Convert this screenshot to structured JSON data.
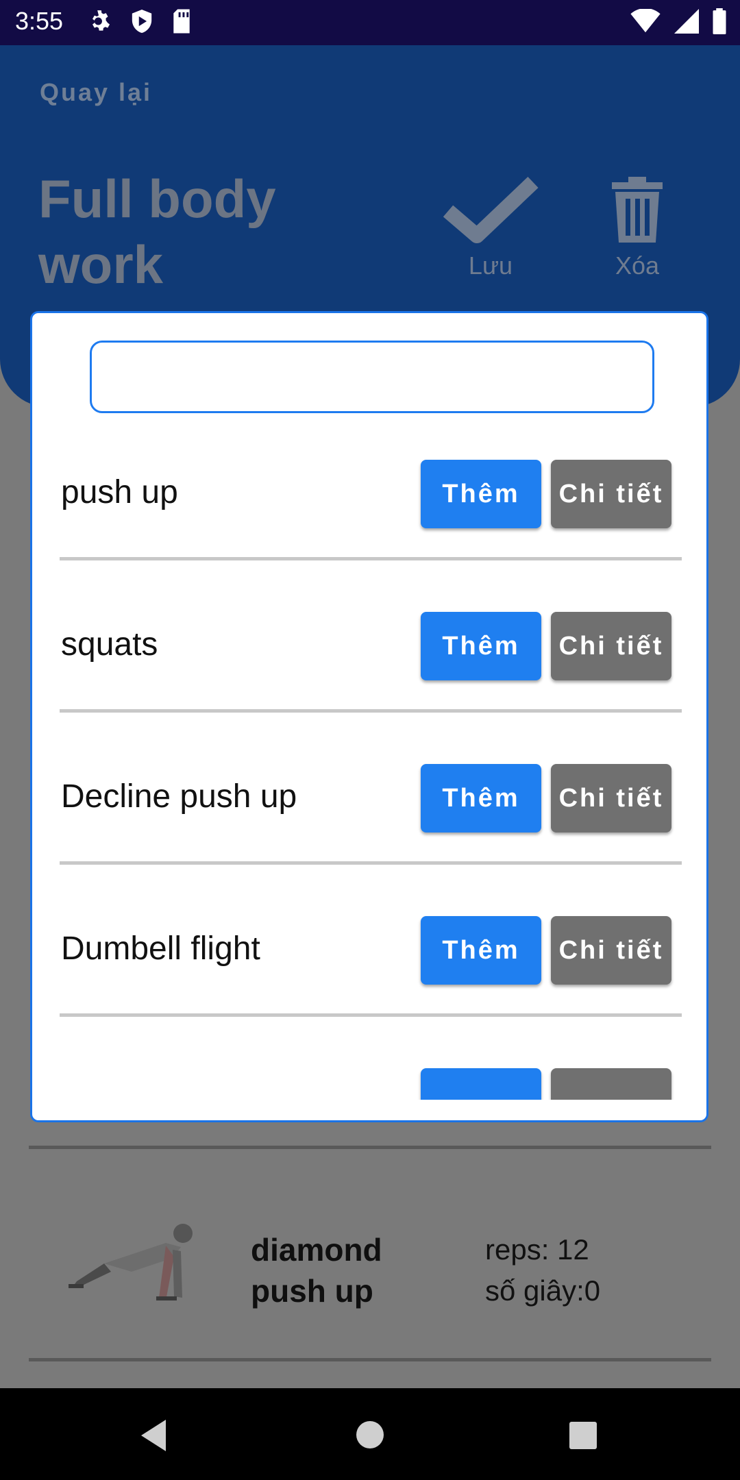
{
  "status_bar": {
    "time": "3:55"
  },
  "header": {
    "back_label": "Quay lại",
    "title": "Full body work",
    "save_label": "Lưu",
    "delete_label": "Xóa"
  },
  "dialog": {
    "search_value": "",
    "exercises": [
      {
        "name": "push up",
        "add_label": "Thêm",
        "detail_label": "Chi tiết"
      },
      {
        "name": "squats",
        "add_label": "Thêm",
        "detail_label": "Chi tiết"
      },
      {
        "name": "Decline push up",
        "add_label": "Thêm",
        "detail_label": "Chi tiết"
      },
      {
        "name": "Dumbell flight",
        "add_label": "Thêm",
        "detail_label": "Chi tiết"
      },
      {
        "name": "",
        "add_label": "",
        "detail_label": ""
      }
    ]
  },
  "workout_list": {
    "items": [
      {
        "name": "diamond push up",
        "reps": "reps: 12",
        "seconds": "số giây:0"
      }
    ]
  },
  "colors": {
    "header_bg": "#103a76",
    "primary_button": "#1f7ff0",
    "secondary_button": "#707070",
    "status_bar": "#120b45"
  }
}
